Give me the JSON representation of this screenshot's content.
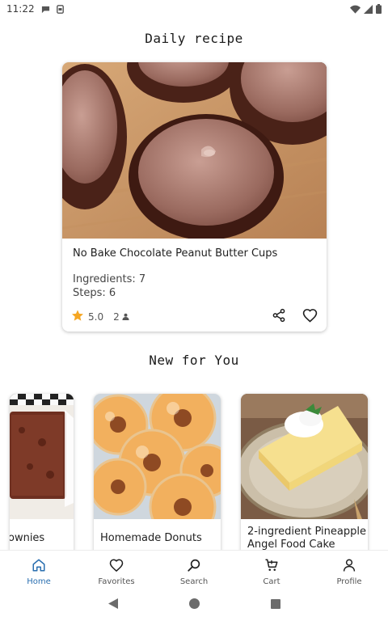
{
  "status_bar": {
    "time": "11:22"
  },
  "daily": {
    "title": "Daily recipe",
    "recipe_name": "No Bake Chocolate Peanut Butter Cups",
    "ingredients": "Ingredients: 7",
    "steps": "Steps: 6",
    "rating": "5.0",
    "servings": "2"
  },
  "new_for_you": {
    "title": "New for You",
    "cards": [
      {
        "name": "ownies"
      },
      {
        "name": "Homemade Donuts"
      },
      {
        "name": "2-ingredient Pineapple Angel Food Cake"
      }
    ]
  },
  "nav": {
    "items": [
      {
        "label": "Home",
        "icon": "home-icon",
        "active": true
      },
      {
        "label": "Favorites",
        "icon": "heart-icon"
      },
      {
        "label": "Search",
        "icon": "search-icon"
      },
      {
        "label": "Cart",
        "icon": "cart-icon"
      },
      {
        "label": "Profile",
        "icon": "person-icon"
      }
    ]
  },
  "colors": {
    "accent": "#2a6fb0",
    "star": "#f5a623"
  }
}
